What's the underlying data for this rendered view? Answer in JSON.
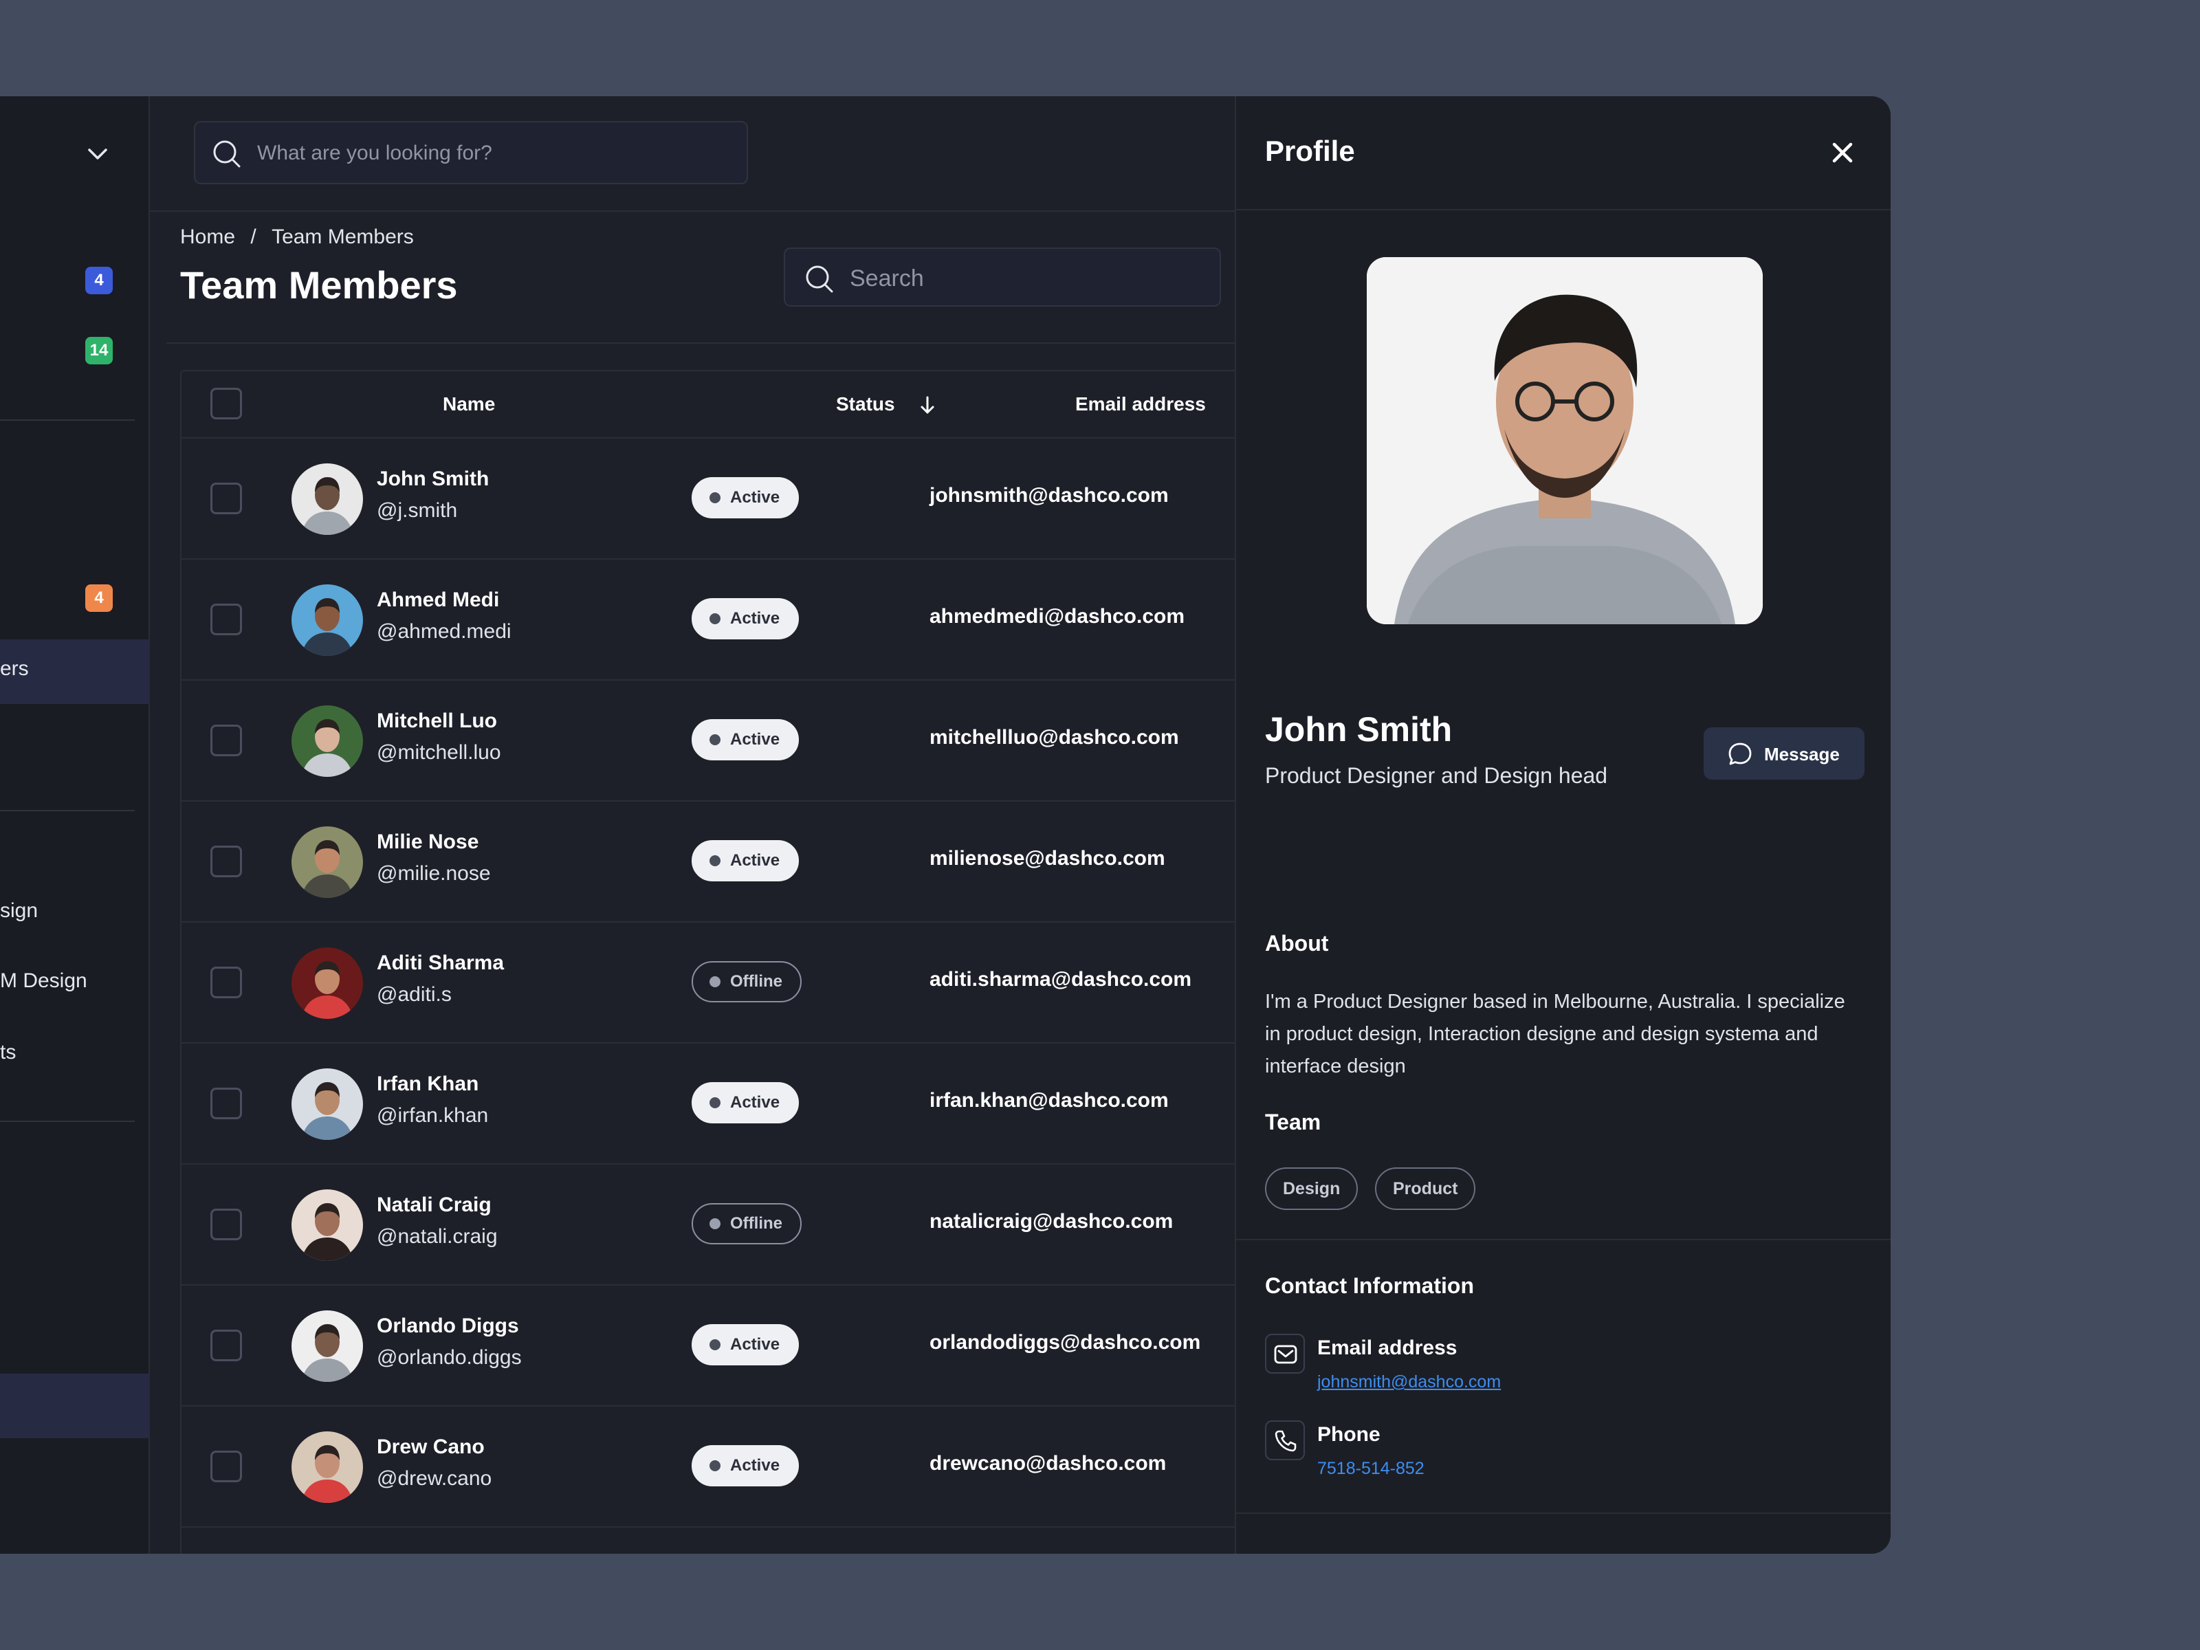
{
  "sidebar": {
    "badges": [
      "4",
      "14",
      "4"
    ],
    "items": [
      "ers",
      "sign",
      "M Design",
      "ts"
    ]
  },
  "search": {
    "placeholder": "What are you looking for?"
  },
  "breadcrumb": {
    "home": "Home",
    "separator": "/",
    "current": "Team Members"
  },
  "page": {
    "title": "Team Members",
    "search_placeholder": "Search"
  },
  "table": {
    "headers": {
      "name": "Name",
      "status": "Status",
      "email": "Email address"
    },
    "rows": [
      {
        "name": "John Smith",
        "handle": "@j.smith",
        "status": "Active",
        "email": "johnsmith@dashco.com"
      },
      {
        "name": "Ahmed Medi",
        "handle": "@ahmed.medi",
        "status": "Active",
        "email": "ahmedmedi@dashco.com"
      },
      {
        "name": "Mitchell Luo",
        "handle": "@mitchell.luo",
        "status": "Active",
        "email": "mitchellluo@dashco.com"
      },
      {
        "name": "Milie Nose",
        "handle": "@milie.nose",
        "status": "Active",
        "email": "milienose@dashco.com"
      },
      {
        "name": "Aditi Sharma",
        "handle": "@aditi.s",
        "status": "Offline",
        "email": "aditi.sharma@dashco.com"
      },
      {
        "name": "Irfan Khan",
        "handle": "@irfan.khan",
        "status": "Active",
        "email": "irfan.khan@dashco.com"
      },
      {
        "name": "Natali Craig",
        "handle": "@natali.craig",
        "status": "Offline",
        "email": "natalicraig@dashco.com"
      },
      {
        "name": "Orlando Diggs",
        "handle": "@orlando.diggs",
        "status": "Active",
        "email": "orlandodiggs@dashco.com"
      },
      {
        "name": "Drew Cano",
        "handle": "@drew.cano",
        "status": "Active",
        "email": "drewcano@dashco.com"
      }
    ]
  },
  "profile": {
    "title": "Profile",
    "name": "John Smith",
    "role": "Product Designer and Design head",
    "message_label": "Message",
    "about_heading": "About",
    "about": "I'm a Product Designer based in Melbourne, Australia. I specialize in product design, Interaction designe and design systema and interface design",
    "team_heading": "Team",
    "teams": [
      "Design",
      "Product"
    ],
    "contact_heading": "Contact Information",
    "email_label": "Email address",
    "email": "johnsmith@dashco.com",
    "phone_label": "Phone",
    "phone": "7518-514-852"
  },
  "colors": {
    "background": "#434c5e",
    "app": "#1e2029",
    "badge_blue": "#3b5bdb",
    "badge_green": "#2fb36a",
    "badge_orange": "#f0874a",
    "link": "#3d8ef0"
  }
}
